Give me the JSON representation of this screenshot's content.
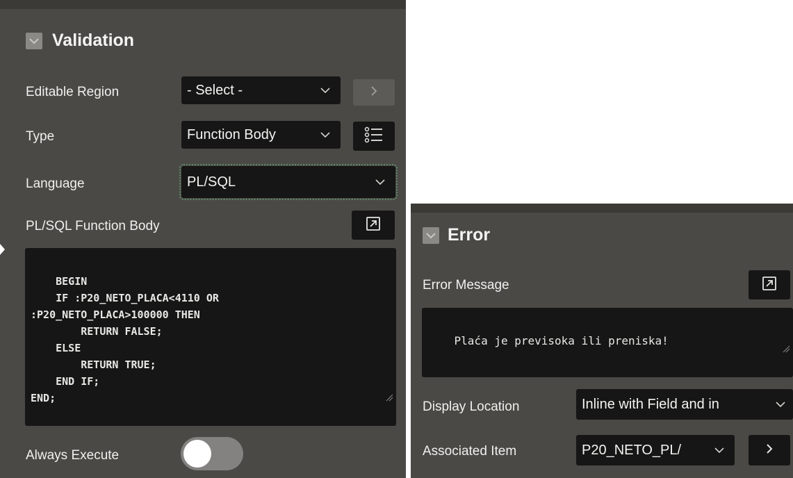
{
  "validation_panel": {
    "title": "Validation",
    "editable_region": {
      "label": "Editable Region",
      "value": "- Select -"
    },
    "type": {
      "label": "Type",
      "value": "Function Body"
    },
    "language": {
      "label": "Language",
      "value": "PL/SQL"
    },
    "function_body": {
      "label": "PL/SQL Function Body",
      "code": "BEGIN\n    IF :P20_NETO_PLACA<4110 OR\n:P20_NETO_PLACA>100000 THEN\n        RETURN FALSE;\n    ELSE\n        RETURN TRUE;\n    END IF;\nEND;"
    },
    "always_execute": {
      "label": "Always Execute",
      "on": false
    }
  },
  "error_panel": {
    "title": "Error",
    "error_message": {
      "label": "Error Message",
      "value": "Plaća je previsoka ili preniska!"
    },
    "display_location": {
      "label": "Display Location",
      "value": "Inline with Field and in"
    },
    "associated_item": {
      "label": "Associated Item",
      "value": "P20_NETO_PL/"
    }
  },
  "icons": {
    "section_toggle": "chevron-down-icon",
    "select_caret": "chevron-down-icon",
    "go_to": "chevron-right-icon",
    "list": "list-icon",
    "expand": "expand-icon",
    "resize": "resize-grip-icon"
  },
  "colors": {
    "panel_background": "#4a4945",
    "field_background": "#161616",
    "text": "#f0f0ee",
    "focus_ring": "#5f8a6a"
  }
}
